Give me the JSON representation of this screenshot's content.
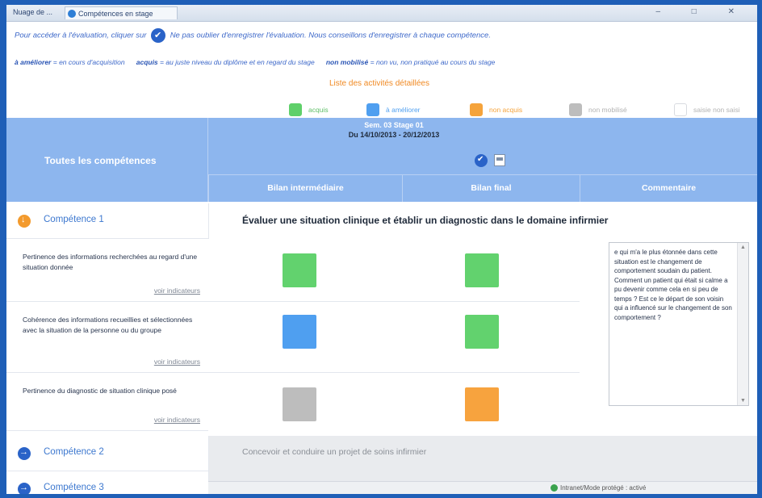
{
  "browser": {
    "selector_label": "Nuage de ...",
    "tab_label": "Compétences en stage",
    "window_controls": "– □ ✕"
  },
  "info": {
    "line1_before": "Pour accéder à l'évaluation, cliquer sur",
    "line1_after": "Ne pas oublier d'enregistrer l'évaluation. Nous conseillons d'enregistrer à chaque compétence.",
    "line2_a_term": "à améliorer",
    "line2_a_def": "= en cours d'acquisition",
    "line2_b_term": "acquis",
    "line2_b_def": "= au juste niveau du diplôme et en regard du stage",
    "line2_c_term": "non mobilisé",
    "line2_c_def": "= non vu, non pratiqué au cours du stage",
    "orange_title": "Liste des activités détaillées"
  },
  "legend": [
    {
      "label": "acquis",
      "color": "#5fd06a"
    },
    {
      "label": "à améliorer",
      "color": "#4f9ff0"
    },
    {
      "label": "non acquis",
      "color": "#f5a33b"
    },
    {
      "label": "non mobilisé",
      "color": "#bdbdbd"
    },
    {
      "label": "saisie non saisi",
      "color": "#ffffff"
    }
  ],
  "header": {
    "all_competences": "Toutes les compétences",
    "semester": "Sem. 03 Stage 01",
    "dates": "Du 14/10/2013 - 20/12/2013",
    "col_intermediate": "Bilan intermédiaire",
    "col_final": "Bilan final",
    "col_comment": "Commentaire"
  },
  "competences": [
    {
      "name": "Compétence 1",
      "title": "Évaluer une situation clinique et établir un diagnostic dans le domaine infirmier",
      "state": "open"
    },
    {
      "name": "Compétence 2",
      "title": "Concevoir et conduire un projet de soins infirmier",
      "state": "closed"
    },
    {
      "name": "Compétence 3",
      "title": "",
      "state": "closed"
    }
  ],
  "criteria": [
    {
      "text": "Pertinence des informations recherchées au regard d'une situation donnée",
      "indicators": "voir indicateurs",
      "intermediate": "#62d26e",
      "final": "#62d26e"
    },
    {
      "text": "Cohérence des informations recueillies et sélectionnées avec la situation de la personne ou du groupe",
      "indicators": "voir indicateurs",
      "intermediate": "#4f9ff0",
      "final": "#62d26e"
    },
    {
      "text": "Pertinence du diagnostic de situation clinique posé",
      "indicators": "voir indicateurs",
      "intermediate": "#bdbdbd",
      "final": "#f7a33e"
    }
  ],
  "comment": "e qui m'a le plus étonnée dans cette situation est le changement de comportement soudain du patient. Comment un patient qui était si calme a pu devenir comme cela en si peu de temps ? Est ce le départ de son voisin qui a influencé sur le changement de son comportement ?",
  "status": "Intranet/Mode protégé : activé"
}
